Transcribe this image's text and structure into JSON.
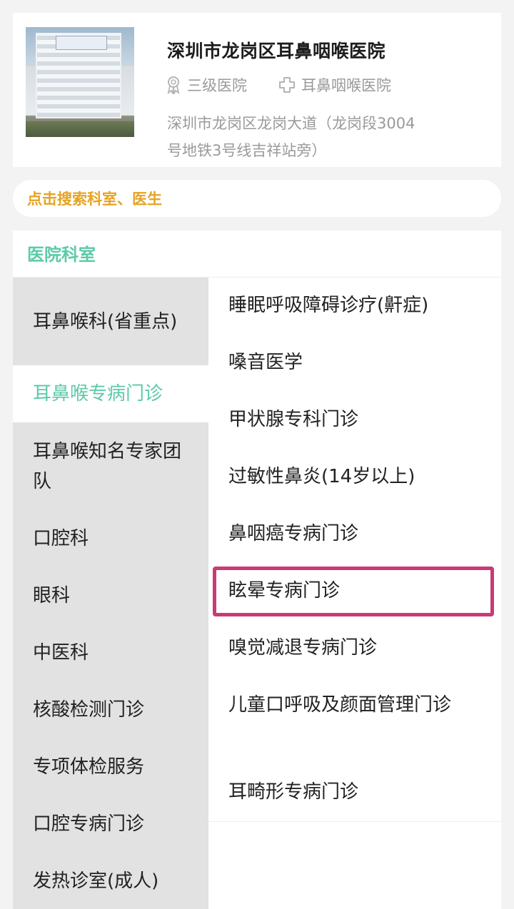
{
  "hospital": {
    "name": "深圳市龙岗区耳鼻咽喉医院",
    "level": "三级医院",
    "level_icon": "award-ribbon-icon",
    "type": "耳鼻咽喉医院",
    "type_icon": "medical-cross-icon",
    "address": "深圳市龙岗区龙岗大道（龙岗段3004号地铁3号线吉祥站旁）"
  },
  "search": {
    "placeholder": "点击搜索科室、医生"
  },
  "departments": {
    "title": "医院科室",
    "categories": [
      {
        "label": "耳鼻喉科(省重点)",
        "active": false
      },
      {
        "label": "耳鼻喉专病门诊",
        "active": true
      },
      {
        "label": "耳鼻喉知名专家团队",
        "active": false
      },
      {
        "label": "口腔科",
        "active": false
      },
      {
        "label": "眼科",
        "active": false
      },
      {
        "label": "中医科",
        "active": false
      },
      {
        "label": "核酸检测门诊",
        "active": false
      },
      {
        "label": "专项体检服务",
        "active": false
      },
      {
        "label": "口腔专病门诊",
        "active": false
      },
      {
        "label": "发热诊室(成人)",
        "active": false
      }
    ],
    "clinics": [
      {
        "label": "睡眠呼吸障碍诊疗(鼾症)"
      },
      {
        "label": "嗓音医学"
      },
      {
        "label": "甲状腺专科门诊"
      },
      {
        "label": "过敏性鼻炎(14岁以上)"
      },
      {
        "label": "鼻咽癌专病门诊"
      },
      {
        "label": "眩晕专病门诊",
        "highlighted": true
      },
      {
        "label": "嗅觉减退专病门诊"
      },
      {
        "label": "儿童口呼吸及颜面管理门诊"
      },
      {
        "label": "耳畸形专病门诊"
      }
    ]
  },
  "colors": {
    "accent": "#5ccaa8",
    "search_text": "#e6a323",
    "highlight_border": "#c63c76",
    "sidebar_bg": "#e2e2e2"
  }
}
